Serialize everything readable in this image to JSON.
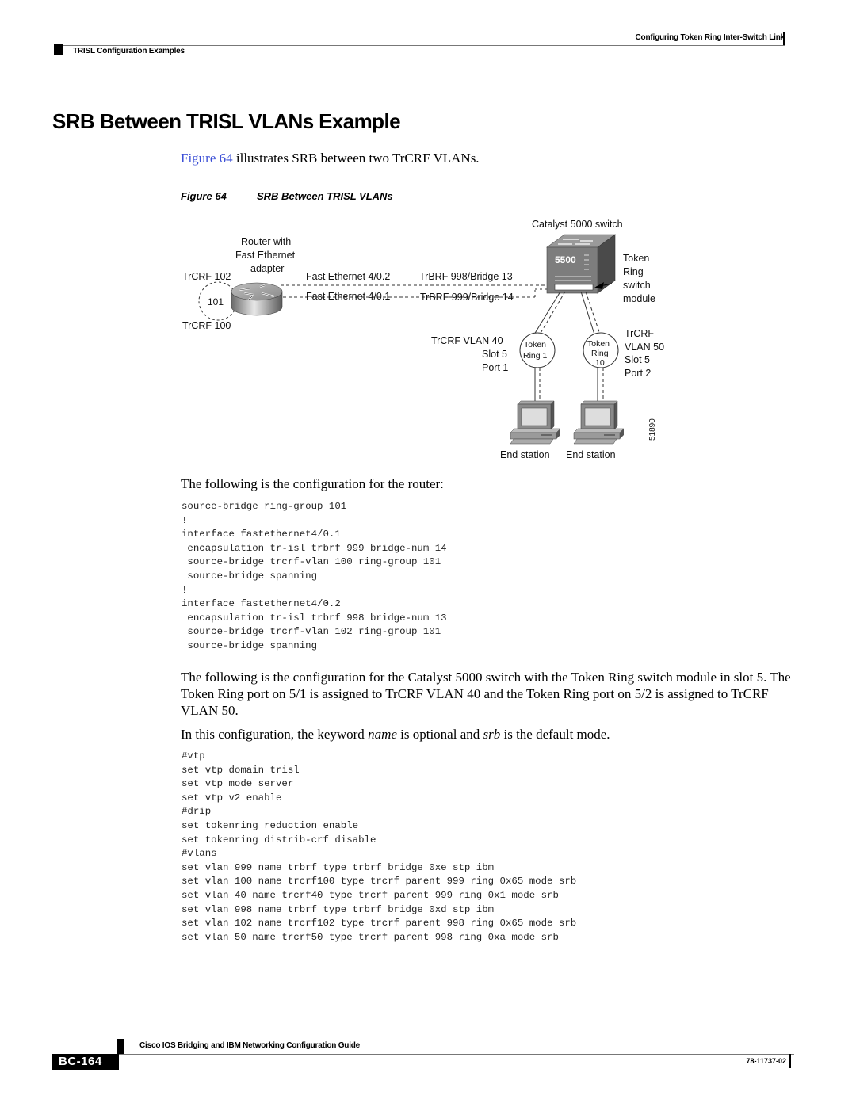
{
  "header": {
    "chapter": "Configuring Token Ring Inter-Switch Link",
    "section": "TRISL Configuration Examples"
  },
  "title": "SRB Between TRISL VLANs Example",
  "intro": {
    "link": "Figure 64",
    "text": " illustrates SRB between two TrCRF VLANs."
  },
  "figure": {
    "number": "Figure 64",
    "caption": "SRB Between TRISL VLANs",
    "labels": {
      "router_line1": "Router with",
      "router_line2": "Fast Ethernet",
      "router_line3": "adapter",
      "trcrf_102": "TrCRF 102",
      "ring_101": "101",
      "trcrf_100": "TrCRF 100",
      "fe_402": "Fast Ethernet 4/0.2",
      "fe_401": "Fast Ethernet 4/0.1",
      "trbrf_998": "TrBRF 998/Bridge 13",
      "trbrf_999": "TrBRF 999/Bridge 14",
      "catalyst": "Catalyst 5000 switch",
      "switch_model": "5500",
      "module_line1": "Token",
      "module_line2": "Ring",
      "module_line3": "switch",
      "module_line4": "module",
      "left_vlan_line1": "TrCRF VLAN 40",
      "left_vlan_line2": "Slot 5",
      "left_vlan_line3": "Port 1",
      "ring1_line1": "Token",
      "ring1_line2": "Ring 1",
      "ring10_line1": "Token",
      "ring10_line2": "Ring",
      "ring10_line3": "10",
      "right_vlan_line1": "TrCRF",
      "right_vlan_line2": "VLAN 50",
      "right_vlan_line3": "Slot 5",
      "right_vlan_line4": "Port 2",
      "end_station_1": "End station",
      "end_station_2": "End station",
      "figure_id": "51890"
    }
  },
  "router_intro": "The following is the configuration for the router:",
  "router_config": [
    "source-bridge ring-group 101",
    "!",
    "interface fastethernet4/0.1",
    " encapsulation tr-isl trbrf 999 bridge-num 14",
    " source-bridge trcrf-vlan 100 ring-group 101",
    " source-bridge spanning",
    "!",
    "interface fastethernet4/0.2",
    " encapsulation tr-isl trbrf 998 bridge-num 13",
    " source-bridge trcrf-vlan 102 ring-group 101",
    " source-bridge spanning"
  ],
  "switch_intro": "The following is the configuration for the Catalyst 5000 switch with the Token Ring switch module in slot 5. The Token Ring port on 5/1 is assigned to TrCRF VLAN 40 and the Token Ring port on 5/2 is assigned to TrCRF VLAN 50.",
  "note": {
    "prefix": "In this configuration, the keyword ",
    "kw1": "name",
    "middle": " is optional and ",
    "kw2": "srb",
    "suffix": " is the default mode."
  },
  "switch_config": [
    "#vtp",
    "set vtp domain trisl",
    "set vtp mode server",
    "set vtp v2 enable",
    "#drip",
    "set tokenring reduction enable",
    "set tokenring distrib-crf disable",
    "#vlans",
    "set vlan 999 name trbrf type trbrf bridge 0xe stp ibm",
    "set vlan 100 name trcrf100 type trcrf parent 999 ring 0x65 mode srb",
    "set vlan 40 name trcrf40 type trcrf parent 999 ring 0x1 mode srb",
    "set vlan 998 name trbrf type trbrf bridge 0xd stp ibm",
    "set vlan 102 name trcrf102 type trcrf parent 998 ring 0x65 mode srb",
    "set vlan 50 name trcrf50 type trcrf parent 998 ring 0xa mode srb"
  ],
  "footer": {
    "guide": "Cisco IOS Bridging and IBM Networking Configuration Guide",
    "page": "BC-164",
    "doc_number": "78-11737-02"
  },
  "colors": {
    "link": "#3b4fd6"
  }
}
